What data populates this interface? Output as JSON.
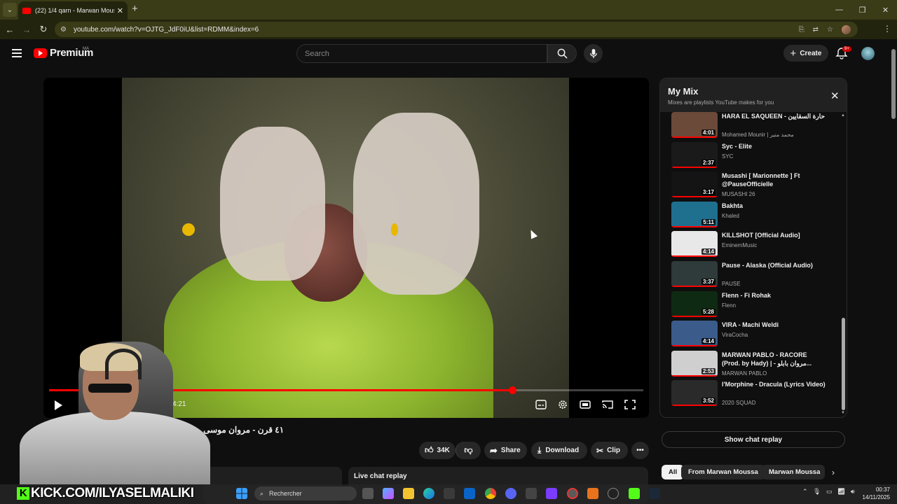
{
  "browser": {
    "tab_title": "(22) 1/4 qarn - Marwan Mouss",
    "url": "youtube.com/watch?v=OJTG_JdF0iU&list=RDMM&index=6"
  },
  "header": {
    "logo_text": "Premium",
    "region": "MA",
    "search_placeholder": "Search",
    "create_label": "Create",
    "notif_count": "9+"
  },
  "player": {
    "time": "4:21",
    "progress": 0.78
  },
  "video": {
    "title": "٤١ قرن - مروان موسى و رع ا",
    "likes": "34K",
    "share": "Share",
    "download": "Download",
    "clip": "Clip",
    "live_chat_replay": "Live chat replay"
  },
  "mix": {
    "title": "My Mix",
    "subtitle": "Mixes are playlists YouTube makes for you",
    "items": [
      {
        "title": "HARA EL SAQUEEN - حارة السقايين",
        "channel": "Mohamed Mounir | محمد منير",
        "duration": "4:01",
        "thumb": "#6b4a3a"
      },
      {
        "title": "Syc - Elite",
        "channel": "SYC",
        "duration": "2:37",
        "thumb": "#1a1a1a"
      },
      {
        "title": "Musashi [ Marionnette ] Ft @PauseOfficielle",
        "channel": "MUSASHI 26",
        "duration": "3:17",
        "thumb": "#141414"
      },
      {
        "title": "Bakhta",
        "channel": "Khaled",
        "duration": "5:11",
        "thumb": "#1f6f8f"
      },
      {
        "title": "KILLSHOT [Official Audio]",
        "channel": "EminemMusic",
        "duration": "4:14",
        "thumb": "#e8e8e8"
      },
      {
        "title": "Pause - Alaska (Official Audio)",
        "channel": "PAUSE",
        "duration": "3:37",
        "thumb": "#2f3a3a"
      },
      {
        "title": "Flenn - Fi Rohak",
        "channel": "Flenn",
        "duration": "5:28",
        "thumb": "#0f2a12"
      },
      {
        "title": "VIRA - Machi Weldi",
        "channel": "ViraCocha",
        "duration": "4:14",
        "thumb": "#3b5c8a"
      },
      {
        "title": "MARWAN PABLO - RACORE (Prod. by Hady) | - مروان بابلو...",
        "channel": "MARWAN PABLO",
        "duration": "2:53",
        "thumb": "#cfcfcf"
      },
      {
        "title": "l'Morphine - Dracula (Lyrics Video)",
        "channel": "2020 SQUAD",
        "duration": "3:52",
        "thumb": "#2a2a2a"
      }
    ]
  },
  "show_chat_replay": "Show chat replay",
  "chips": [
    "All",
    "From Marwan Moussa",
    "Marwan Moussa"
  ],
  "stream_overlay": "KICK.COM/ILYASELMALIKI",
  "taskbar": {
    "search_label": "Rechercher",
    "time": "00:37",
    "date": "14/11/2025"
  }
}
